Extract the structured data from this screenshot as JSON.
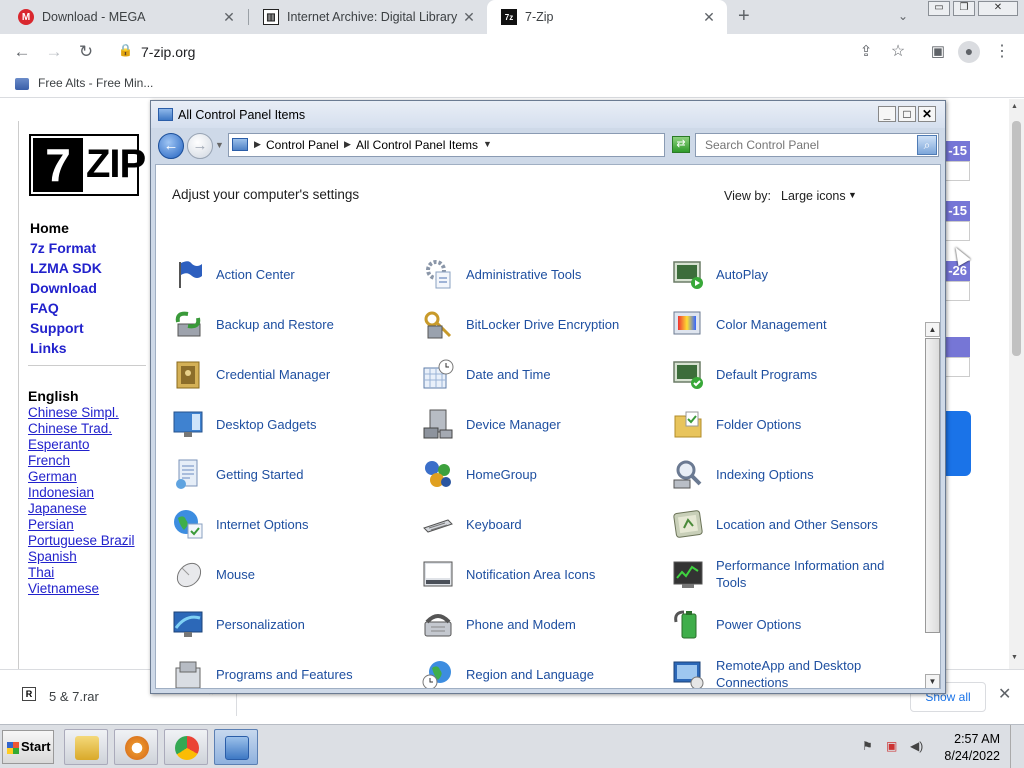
{
  "browser": {
    "tabs": [
      {
        "title": "Download - MEGA",
        "favicon_color": "#d9272e",
        "favicon_glyph": "M",
        "active": false
      },
      {
        "title": "Internet Archive: Digital Library o",
        "favicon_color": "#222222",
        "favicon_glyph": "🏛",
        "active": false
      },
      {
        "title": "7-Zip",
        "favicon_color": "#111111",
        "favicon_glyph": "7z",
        "active": true
      }
    ],
    "new_tab_glyph": "+",
    "url": "7-zip.org",
    "bookmark": "Free Alts - Free Min..."
  },
  "site": {
    "logo_number": "7",
    "logo_text": "ZIP",
    "nav": [
      "Home",
      "7z Format",
      "LZMA SDK",
      "Download",
      "FAQ",
      "Support",
      "Links"
    ],
    "languages_heading": "English",
    "languages": [
      "Chinese Simpl.",
      "Chinese Trad.",
      "Esperanto",
      "French",
      "German",
      "Indonesian",
      "Japanese",
      "Persian",
      "Portuguese Brazil",
      "Spanish",
      "Thai",
      "Vietnamese"
    ],
    "date_cells": [
      "-15",
      "-15",
      "-26"
    ],
    "accent_color": "#7676d6"
  },
  "download_bar": {
    "file_name": "5 & 7.rar",
    "show_all": "Show all"
  },
  "control_panel": {
    "window_title": "All Control Panel Items",
    "breadcrumbs": [
      "Control Panel",
      "All Control Panel Items"
    ],
    "search_placeholder": "Search Control Panel",
    "heading": "Adjust your computer's settings",
    "view_by_label": "View by:",
    "view_by_value": "Large icons",
    "items": [
      {
        "label": "Action Center",
        "icon": "flag-icon"
      },
      {
        "label": "Administrative Tools",
        "icon": "admin-tools-icon"
      },
      {
        "label": "AutoPlay",
        "icon": "autoplay-icon"
      },
      {
        "label": "Backup and Restore",
        "icon": "backup-icon"
      },
      {
        "label": "BitLocker Drive Encryption",
        "icon": "bitlocker-icon"
      },
      {
        "label": "Color Management",
        "icon": "color-management-icon"
      },
      {
        "label": "Credential Manager",
        "icon": "credential-icon"
      },
      {
        "label": "Date and Time",
        "icon": "clock-calendar-icon"
      },
      {
        "label": "Default Programs",
        "icon": "default-programs-icon"
      },
      {
        "label": "Desktop Gadgets",
        "icon": "gadgets-icon"
      },
      {
        "label": "Device Manager",
        "icon": "device-manager-icon"
      },
      {
        "label": "Folder Options",
        "icon": "folder-icon"
      },
      {
        "label": "Getting Started",
        "icon": "getting-started-icon"
      },
      {
        "label": "HomeGroup",
        "icon": "homegroup-icon"
      },
      {
        "label": "Indexing Options",
        "icon": "indexing-icon"
      },
      {
        "label": "Internet Options",
        "icon": "globe-icon"
      },
      {
        "label": "Keyboard",
        "icon": "keyboard-icon"
      },
      {
        "label": "Location and Other Sensors",
        "icon": "sensors-icon"
      },
      {
        "label": "Mouse",
        "icon": "mouse-icon"
      },
      {
        "label": "Notification Area Icons",
        "icon": "notification-icon"
      },
      {
        "label": "Performance Information and Tools",
        "icon": "performance-icon"
      },
      {
        "label": "Personalization",
        "icon": "personalization-icon"
      },
      {
        "label": "Phone and Modem",
        "icon": "phone-icon"
      },
      {
        "label": "Power Options",
        "icon": "power-icon"
      },
      {
        "label": "Programs and Features",
        "icon": "programs-icon"
      },
      {
        "label": "Region and Language",
        "icon": "region-icon"
      },
      {
        "label": "RemoteApp and Desktop Connections",
        "icon": "remoteapp-icon"
      }
    ]
  },
  "taskbar": {
    "start_label": "Start",
    "time": "2:57 AM",
    "date": "8/24/2022"
  }
}
